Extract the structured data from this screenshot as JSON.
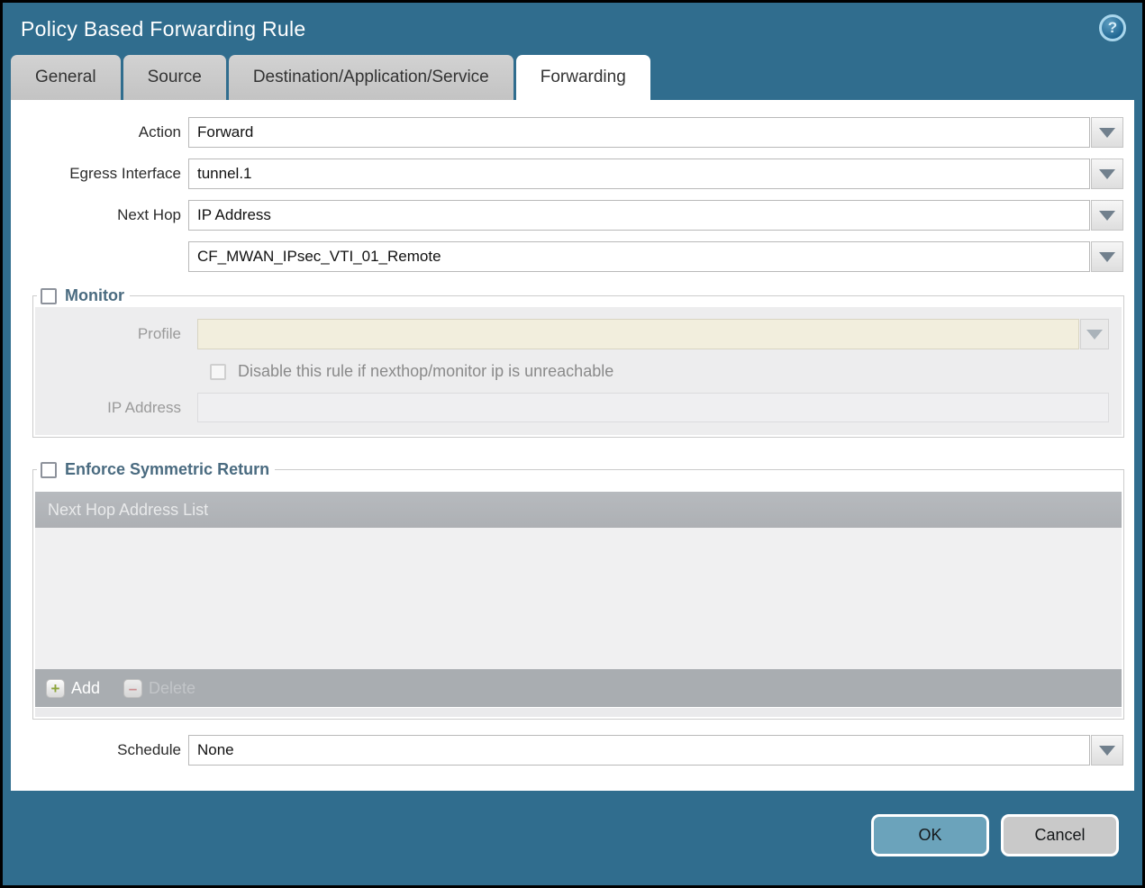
{
  "dialog": {
    "title": "Policy Based Forwarding Rule",
    "help_icon": "question-mark-circle"
  },
  "tabs": [
    {
      "label": "General",
      "active": false
    },
    {
      "label": "Source",
      "active": false
    },
    {
      "label": "Destination/Application/Service",
      "active": false
    },
    {
      "label": "Forwarding",
      "active": true
    }
  ],
  "form": {
    "action": {
      "label": "Action",
      "value": "Forward"
    },
    "egress_interface": {
      "label": "Egress Interface",
      "value": "tunnel.1"
    },
    "next_hop": {
      "label": "Next Hop",
      "value": "IP Address"
    },
    "next_hop_address": {
      "value": "CF_MWAN_IPsec_VTI_01_Remote"
    },
    "schedule": {
      "label": "Schedule",
      "value": "None"
    }
  },
  "monitor": {
    "label": "Monitor",
    "checked": false,
    "profile": {
      "label": "Profile",
      "value": ""
    },
    "disable_rule": {
      "label": "Disable this rule if nexthop/monitor ip is unreachable",
      "checked": false
    },
    "ip_address": {
      "label": "IP Address",
      "value": ""
    }
  },
  "symmetric_return": {
    "label": "Enforce Symmetric Return",
    "checked": false,
    "table_header": "Next Hop Address List",
    "rows": [],
    "add_label": "Add",
    "delete_label": "Delete",
    "delete_enabled": false
  },
  "footer": {
    "ok_label": "OK",
    "cancel_label": "Cancel"
  },
  "colors": {
    "chrome_teal": "#306d8e",
    "ok_button": "#6ba3bb",
    "cancel_button": "#c9c9c9",
    "profile_field_beige": "#f2eedd",
    "table_header_gray": "#b2b5b9",
    "add_icon_green": "#8da53b",
    "delete_icon_red": "#cb8e91"
  }
}
